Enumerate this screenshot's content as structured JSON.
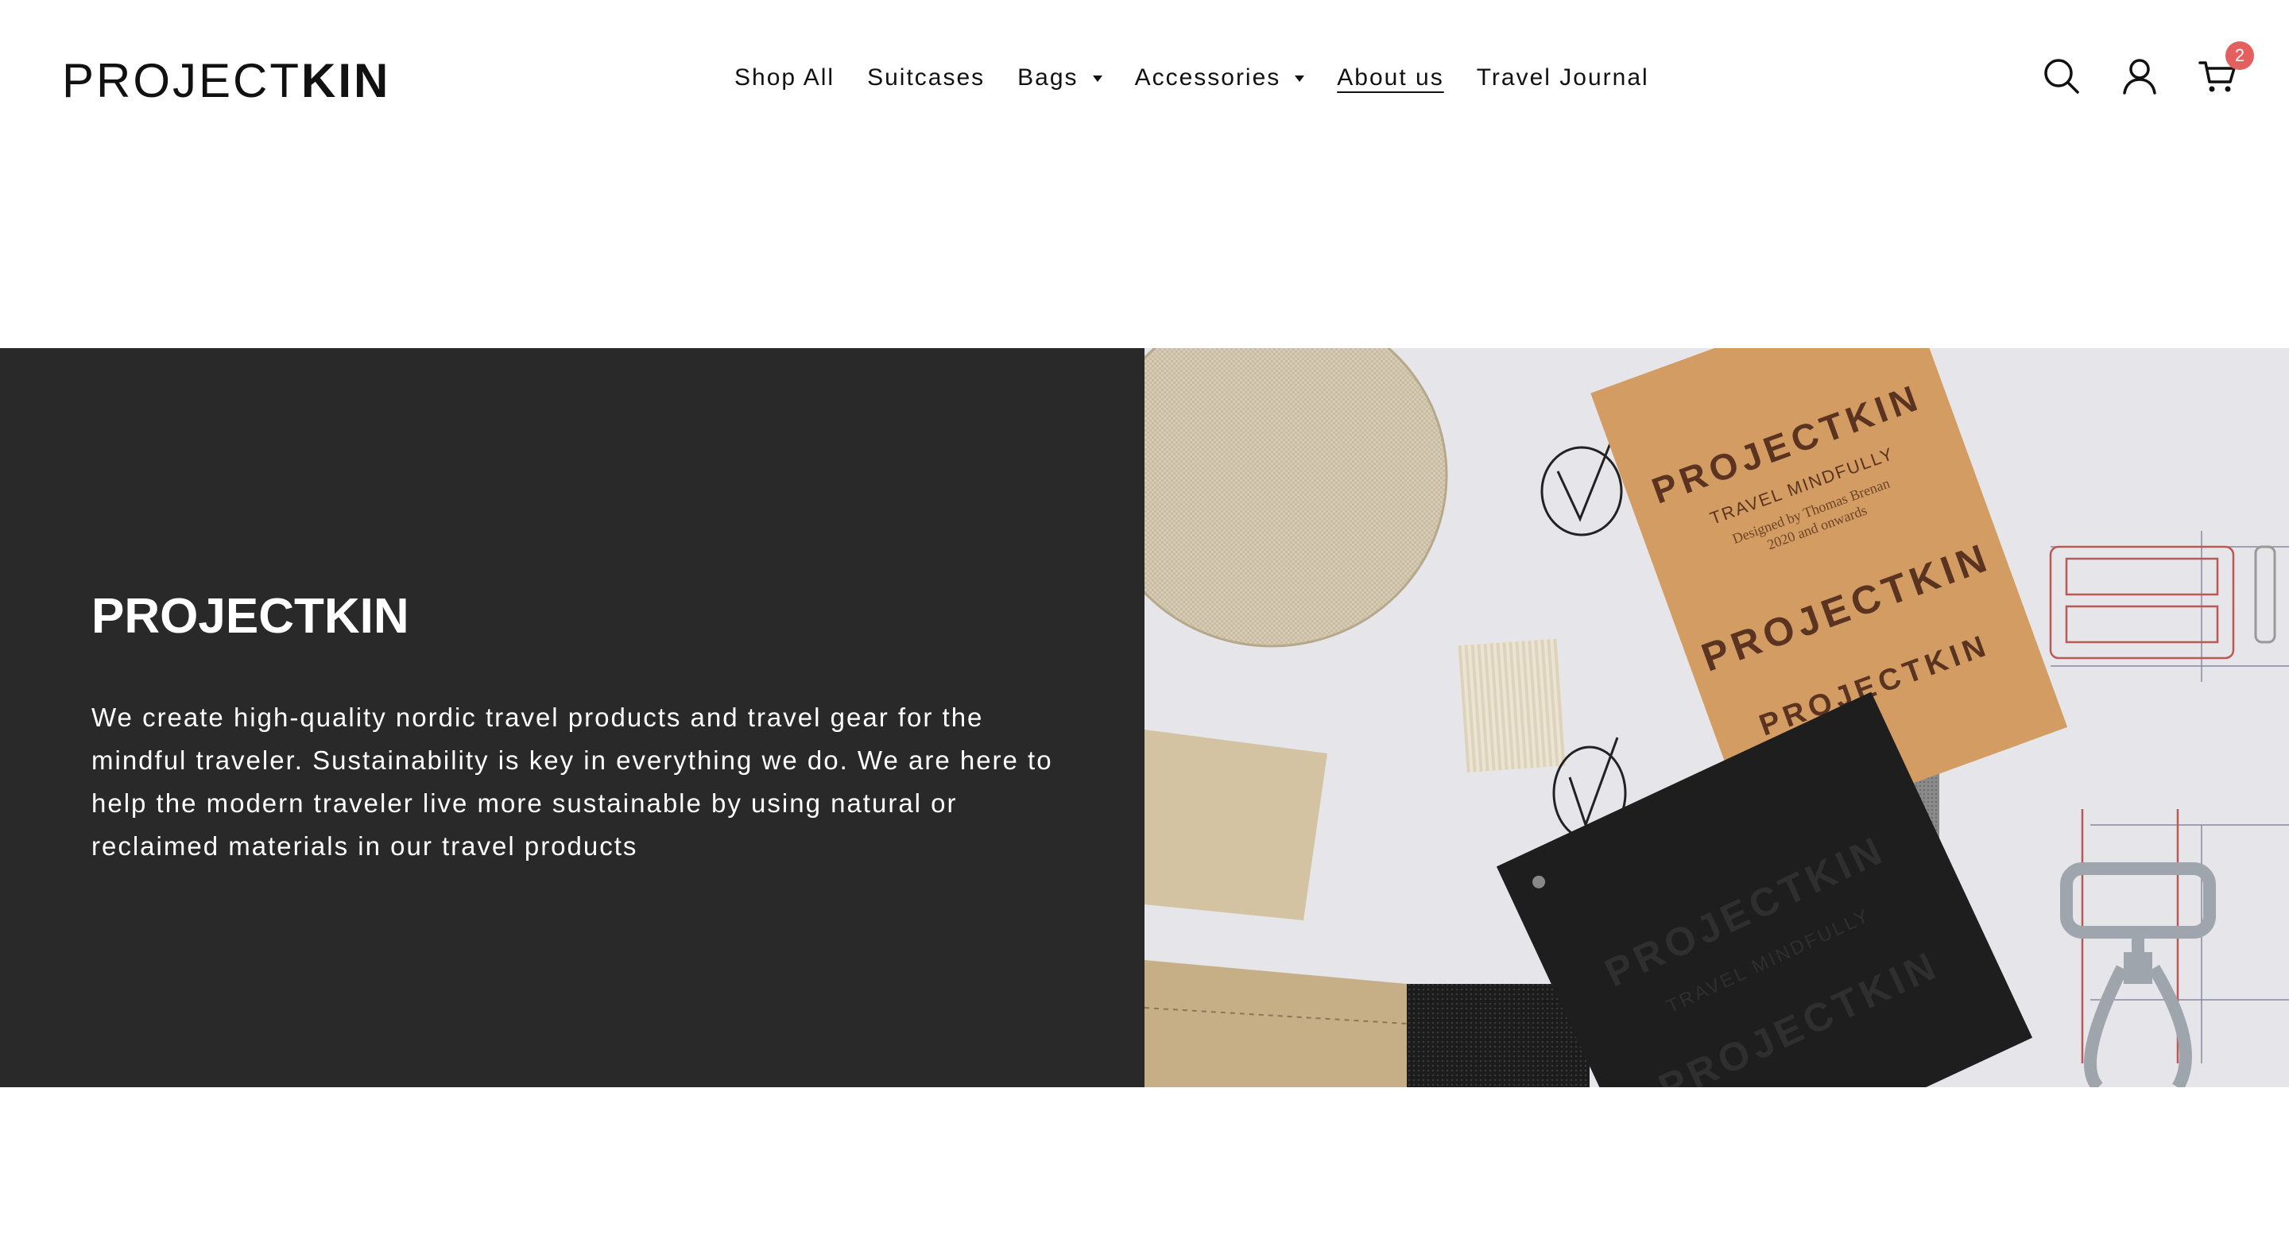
{
  "brand": {
    "logo_light": "PROJECT",
    "logo_bold": "KIN"
  },
  "nav": {
    "items": [
      {
        "label": "Shop All",
        "has_dropdown": false,
        "active": false
      },
      {
        "label": "Suitcases",
        "has_dropdown": false,
        "active": false
      },
      {
        "label": "Bags",
        "has_dropdown": true,
        "active": false
      },
      {
        "label": "Accessories",
        "has_dropdown": true,
        "active": false
      },
      {
        "label": "About us",
        "has_dropdown": false,
        "active": true
      },
      {
        "label": "Travel Journal",
        "has_dropdown": false,
        "active": false
      }
    ]
  },
  "header_icons": {
    "search": "search-icon",
    "account": "user-icon",
    "cart": "cart-icon",
    "cart_count": "2",
    "badge_color": "#e4605e"
  },
  "hero": {
    "title": "PROJECTKIN",
    "text": "We create high-quality nordic travel products and travel gear for the mindful traveler. Sustainability is key in everything we do. We are here to help the modern traveler live more sustainable by using natural or reclaimed materials in our travel products",
    "panel_color": "#292929",
    "image": {
      "tag_text_1": "PROJECTKIN",
      "tag_text_2": "TRAVEL MINDFULLY",
      "tag_text_3": "Designed by Thomas Brenan",
      "tag_text_4": "2020 and onwards"
    }
  }
}
